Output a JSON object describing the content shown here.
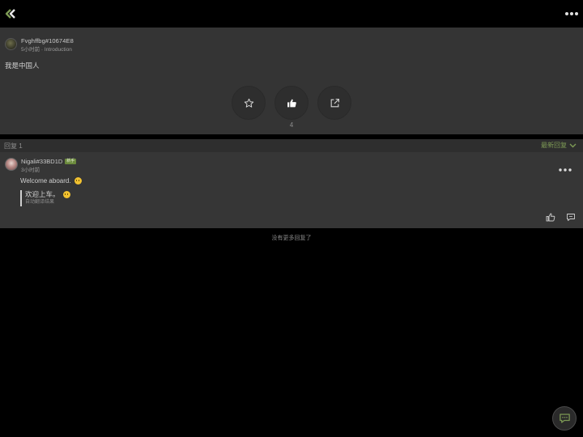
{
  "colors": {
    "accent": "#7d9a55",
    "background": "#000000",
    "panel": "#343434",
    "reply_panel": "#363636"
  },
  "header": {
    "back_icon": "double-chevron-left-icon",
    "more_icon": "more-dots-icon"
  },
  "post": {
    "author": "Fvghffbg#10674E8",
    "meta": "5小时前 · Introduction",
    "body": "我是中国人",
    "actions": [
      {
        "name": "favorite",
        "icon": "star-icon"
      },
      {
        "name": "like",
        "icon": "thumbs-up-icon"
      },
      {
        "name": "share",
        "icon": "share-icon"
      }
    ],
    "like_count": "4"
  },
  "replies_header": {
    "count_label": "回复 1",
    "sort_label": "最新回复"
  },
  "reply": {
    "author": "Nigali#33BD1D",
    "badge": "新手",
    "time": "3小时前",
    "text": "Welcome aboard.",
    "translated_text": "欢迎上车。",
    "translation_label": "自动翻译结果"
  },
  "footer": {
    "no_more": "没有更多回复了"
  },
  "fab": {
    "icon": "chat-bubble-icon"
  }
}
